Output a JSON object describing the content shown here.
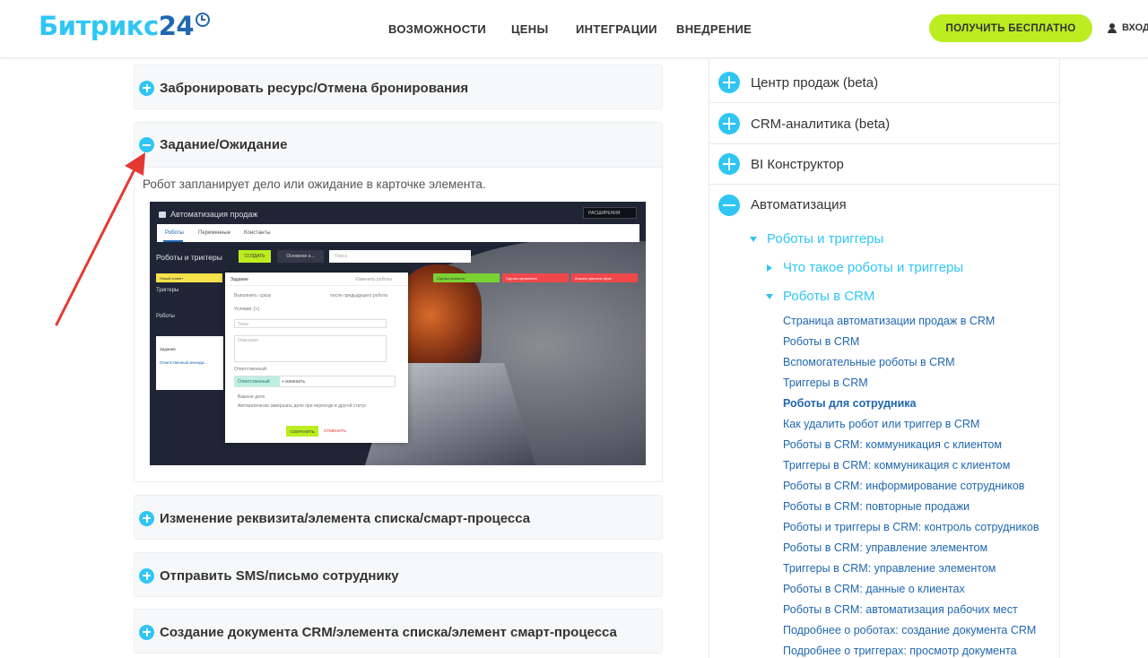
{
  "header": {
    "logo_part1": "Битрикс",
    "logo_part2": "24",
    "nav": [
      "ВОЗМОЖНОСТИ",
      "ЦЕНЫ",
      "ИНТЕГРАЦИИ",
      "ВНЕДРЕНИЕ"
    ],
    "cta_label": "ПОЛУЧИТЬ БЕСПЛАТНО",
    "login_label": "ВХОД"
  },
  "accordion": [
    {
      "title": "Забронировать ресурс/Отмена бронирования",
      "state": "collapsed"
    },
    {
      "title": "Задание/Ожидание",
      "state": "expanded",
      "description": "Робот запланирует дело или ожидание в карточке элемента."
    },
    {
      "title": "Изменение реквизита/элемента списка/смарт-процесса",
      "state": "collapsed"
    },
    {
      "title": "Отправить SMS/письмо сотруднику",
      "state": "collapsed"
    },
    {
      "title": "Создание документа CRM/элемента списка/элемент смарт-процесса",
      "state": "collapsed"
    }
  ],
  "screenshot": {
    "title": "Автоматизация продаж",
    "extensions": "РАСШИРЕНИЯ",
    "tabs": [
      "Роботы",
      "Переменные",
      "Константы"
    ],
    "heading": "Роботы и триггеры",
    "create_label": "СОЗДАТЬ",
    "main_label": "Основное н...",
    "search_placeholder": "Поиск",
    "stages": [
      "Новый клиент",
      "Сделка успешна",
      "Сделка провалена",
      "Анализ причины пров."
    ],
    "row_triggers": "Триггеры",
    "row_robots": "Роботы",
    "card": {
      "line1": "Задание",
      "line2": "Ответственный менедж..."
    },
    "modal": {
      "title": "Задание",
      "link": "Изменить роботы",
      "run": "Выполнить: сразу",
      "cond": "Условие: [+]",
      "after_prev": "после предыдущего робота",
      "subject_ph": "Тема",
      "desc_ph": "Описание",
      "resp_label": "Ответственный:",
      "resp_value": "Ответственный",
      "change": "+ изменить",
      "important": "Важное дело",
      "auto_complete": "Автоматически завершать дело при переходе в другой статус",
      "save": "СОХРАНИТЬ",
      "cancel": "ОТМЕНИТЬ"
    }
  },
  "sidebar": {
    "top_items": [
      {
        "label": "Центр продаж (beta)",
        "state": "collapsed"
      },
      {
        "label": "CRM-аналитика (beta)",
        "state": "collapsed"
      },
      {
        "label": "BI Конструктор",
        "state": "collapsed"
      },
      {
        "label": "Автоматизация",
        "state": "expanded"
      }
    ],
    "sub1": "Роботы и триггеры",
    "sub2a": "Что такое роботы и триггеры",
    "sub2b": "Роботы в CRM",
    "links": [
      "Страница автоматизации продаж в CRM",
      "Роботы в CRM",
      "Вспомогательные роботы в CRM",
      "Триггеры в CRM",
      "Роботы для сотрудника",
      "Как удалить робот или триггер в CRM",
      "Роботы в CRM: коммуникация с клиентом",
      "Триггеры в CRM: коммуникация с клиентом",
      "Роботы в CRM: информирование сотрудников",
      "Роботы в CRM: повторные продажи",
      "Роботы и триггеры в CRM: контроль сотрудников",
      "Роботы в CRM: управление элементом",
      "Триггеры в CRM: управление элементом",
      "Роботы в CRM: данные о клиентах",
      "Роботы в CRM: автоматизация рабочих мест",
      "Подробнее о роботах: создание документа CRM",
      "Подробнее о триггерах: просмотр документа"
    ],
    "active_link": "Роботы для сотрудника"
  },
  "colors": {
    "accent": "#2fc6f6",
    "brand": "#2067b0",
    "cta": "#bbed21",
    "arrow": "#e53935"
  }
}
